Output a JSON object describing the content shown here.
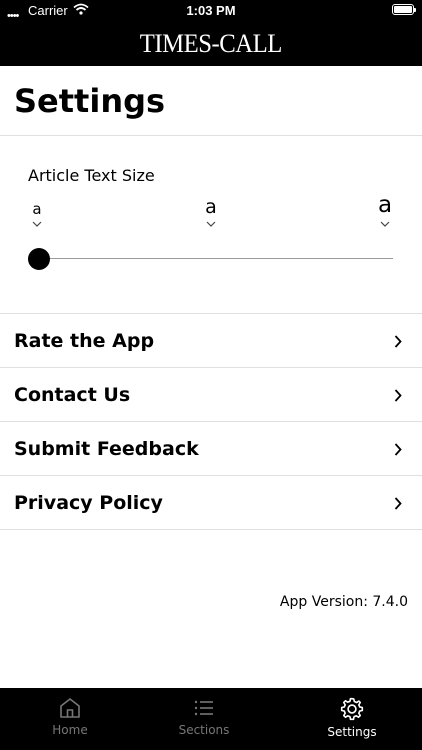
{
  "status_bar": {
    "carrier": "Carrier",
    "time": "1:03 PM"
  },
  "header": {
    "logo": "TIMES-CALL"
  },
  "page": {
    "title": "Settings"
  },
  "text_size": {
    "label": "Article Text Size",
    "options": [
      {
        "glyph": "a"
      },
      {
        "glyph": "a"
      },
      {
        "glyph": "a"
      }
    ],
    "selected_index": 0
  },
  "menu": {
    "items": [
      {
        "label": "Rate the App"
      },
      {
        "label": "Contact Us"
      },
      {
        "label": "Submit Feedback"
      },
      {
        "label": "Privacy Policy"
      }
    ]
  },
  "footer": {
    "version": "App Version: 7.4.0"
  },
  "tabbar": {
    "tabs": [
      {
        "label": "Home",
        "icon": "home-icon"
      },
      {
        "label": "Sections",
        "icon": "list-icon"
      },
      {
        "label": "Settings",
        "icon": "gear-icon"
      }
    ],
    "active_index": 2
  },
  "colors": {
    "bar_background": "#000000",
    "inactive_tab": "#777777",
    "active_tab": "#ffffff"
  }
}
